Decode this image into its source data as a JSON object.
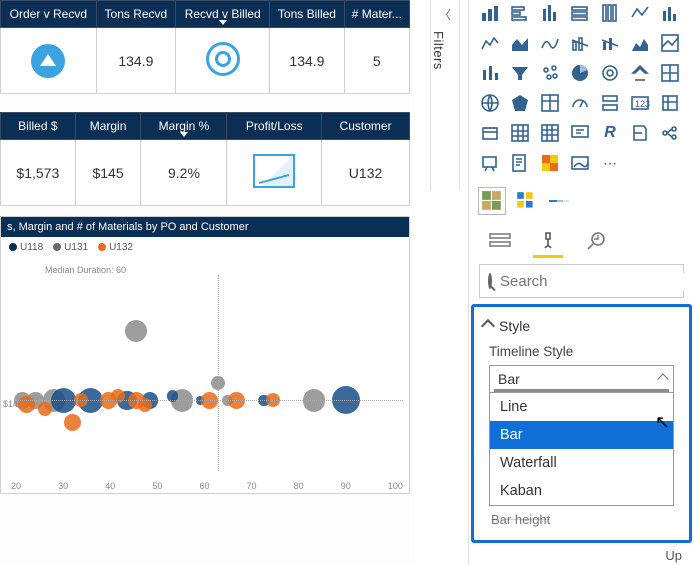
{
  "filters_label": "Filters",
  "table1": {
    "headers": [
      "Order v Recvd",
      "Tons Recvd",
      "Recvd v Billed",
      "Tons Billed",
      "# Mater..."
    ],
    "row": {
      "tons_recvd": "134.9",
      "tons_billed": "134.9",
      "num_mater": "5"
    }
  },
  "table2": {
    "headers": [
      "Billed $",
      "Margin",
      "Margin %",
      "Profit/Loss",
      "Customer"
    ],
    "row": {
      "billed": "$1,573",
      "margin": "$145",
      "margin_pct": "9.2%",
      "customer": "U132"
    }
  },
  "chart": {
    "title": "s, Margin and # of Materials by PO and Customer",
    "legend": [
      "U118",
      "U131",
      "U132"
    ],
    "median_label": "Median Duration: 60",
    "y_tick": "$14",
    "x_ticks": [
      "20",
      "30",
      "40",
      "50",
      "60",
      "70",
      "80",
      "90",
      "100"
    ]
  },
  "chart_data": {
    "type": "scatter",
    "xlabel": "",
    "ylabel": "",
    "xlim": [
      15,
      100
    ],
    "series": [
      {
        "name": "U131",
        "color": "#8c8c8c",
        "points": [
          {
            "x": 42,
            "y": 30,
            "r": 8
          },
          {
            "x": 17,
            "y": 14,
            "r": 6
          },
          {
            "x": 20,
            "y": 14,
            "r": 6
          },
          {
            "x": 24,
            "y": 14,
            "r": 8
          },
          {
            "x": 52,
            "y": 14,
            "r": 8
          },
          {
            "x": 60,
            "y": 18,
            "r": 5
          },
          {
            "x": 81,
            "y": 14,
            "r": 8
          },
          {
            "x": 62,
            "y": 14,
            "r": 4
          }
        ]
      },
      {
        "name": "U118",
        "color": "#1a4f8a",
        "points": [
          {
            "x": 26,
            "y": 14,
            "r": 9
          },
          {
            "x": 32,
            "y": 14,
            "r": 9
          },
          {
            "x": 40,
            "y": 14,
            "r": 7
          },
          {
            "x": 45,
            "y": 14,
            "r": 6
          },
          {
            "x": 50,
            "y": 15,
            "r": 4
          },
          {
            "x": 56,
            "y": 14,
            "r": 3
          },
          {
            "x": 70,
            "y": 14,
            "r": 4
          },
          {
            "x": 88,
            "y": 14,
            "r": 10
          }
        ]
      },
      {
        "name": "U132",
        "color": "#e86c1a",
        "points": [
          {
            "x": 18,
            "y": 13,
            "r": 6
          },
          {
            "x": 22,
            "y": 12,
            "r": 5
          },
          {
            "x": 28,
            "y": 9,
            "r": 6
          },
          {
            "x": 30,
            "y": 14,
            "r": 5
          },
          {
            "x": 36,
            "y": 14,
            "r": 6
          },
          {
            "x": 38,
            "y": 15,
            "r": 5
          },
          {
            "x": 42,
            "y": 14,
            "r": 6
          },
          {
            "x": 44,
            "y": 13,
            "r": 5
          },
          {
            "x": 58,
            "y": 14,
            "r": 6
          },
          {
            "x": 64,
            "y": 14,
            "r": 6
          },
          {
            "x": 72,
            "y": 14,
            "r": 5
          }
        ]
      }
    ]
  },
  "format_pane": {
    "search_placeholder": "Search",
    "section": "Style",
    "prop_label": "Timeline Style",
    "current_value": "Bar",
    "options": [
      "Line",
      "Bar",
      "Waterfall",
      "Kaban"
    ],
    "selected_option": "Bar",
    "next_prop": "Bar height"
  },
  "footer_link": "Up"
}
